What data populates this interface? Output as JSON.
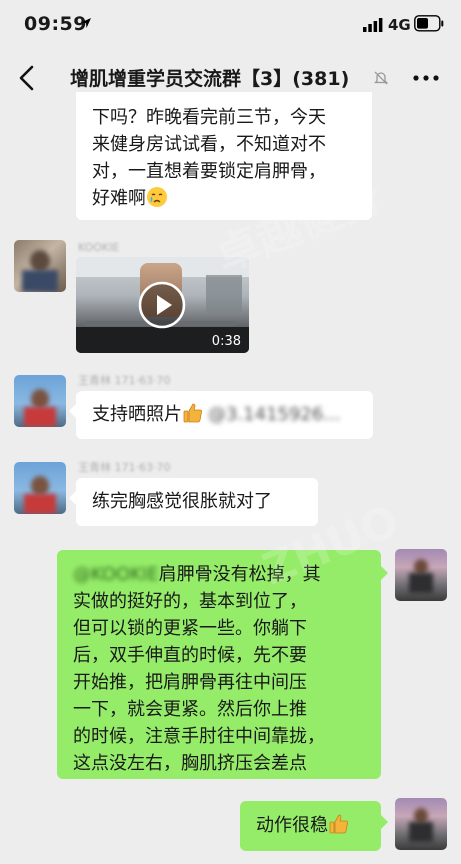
{
  "status_bar": {
    "time": "09:59",
    "network": "4G"
  },
  "header": {
    "title": "增肌增重学员交流群【3】",
    "count": "(381)"
  },
  "messages": {
    "m1": {
      "lines": [
        "下吗？昨晚看完前三节，今天",
        "来健身房试试看，不知道对不",
        "对，一直想着要锁定肩胛骨，",
        "好难啊"
      ]
    },
    "m2": {
      "nick": "KOOKIE",
      "duration": "0:38"
    },
    "m3": {
      "nick": "王青林 171·63·70",
      "text": "支持晒照片",
      "mention": "@3.1415926..."
    },
    "m4": {
      "nick": "王青林 171·63·70",
      "text": "练完胸感觉很胀就对了"
    },
    "m5": {
      "mention": "@KOOKIE",
      "lines": [
        "肩胛骨没有松掉，其",
        "实做的挺好的，基本到位了，",
        "但可以锁的更紧一些。你躺下",
        "后，双手伸直的时候，先不要",
        "开始推，把肩胛骨再往中间压",
        "一下，就会更紧。然后你上推",
        "的时候，注意手肘往中间靠拢，",
        "这点没左右，胸肌挤压会差点"
      ]
    },
    "m6": {
      "text": "动作很稳"
    }
  },
  "watermark": {
    "brand": "ZHUO",
    "cn": "卓越健身"
  },
  "colors": {
    "background": "#ededed",
    "self_bubble": "#95ec69",
    "other_bubble": "#ffffff"
  },
  "icons": [
    "location-arrow-icon",
    "signal-icon",
    "battery-icon",
    "back-chevron-icon",
    "mute-bell-icon",
    "more-dots-icon",
    "play-icon",
    "thumbs-up-emoji",
    "crying-emoji"
  ]
}
